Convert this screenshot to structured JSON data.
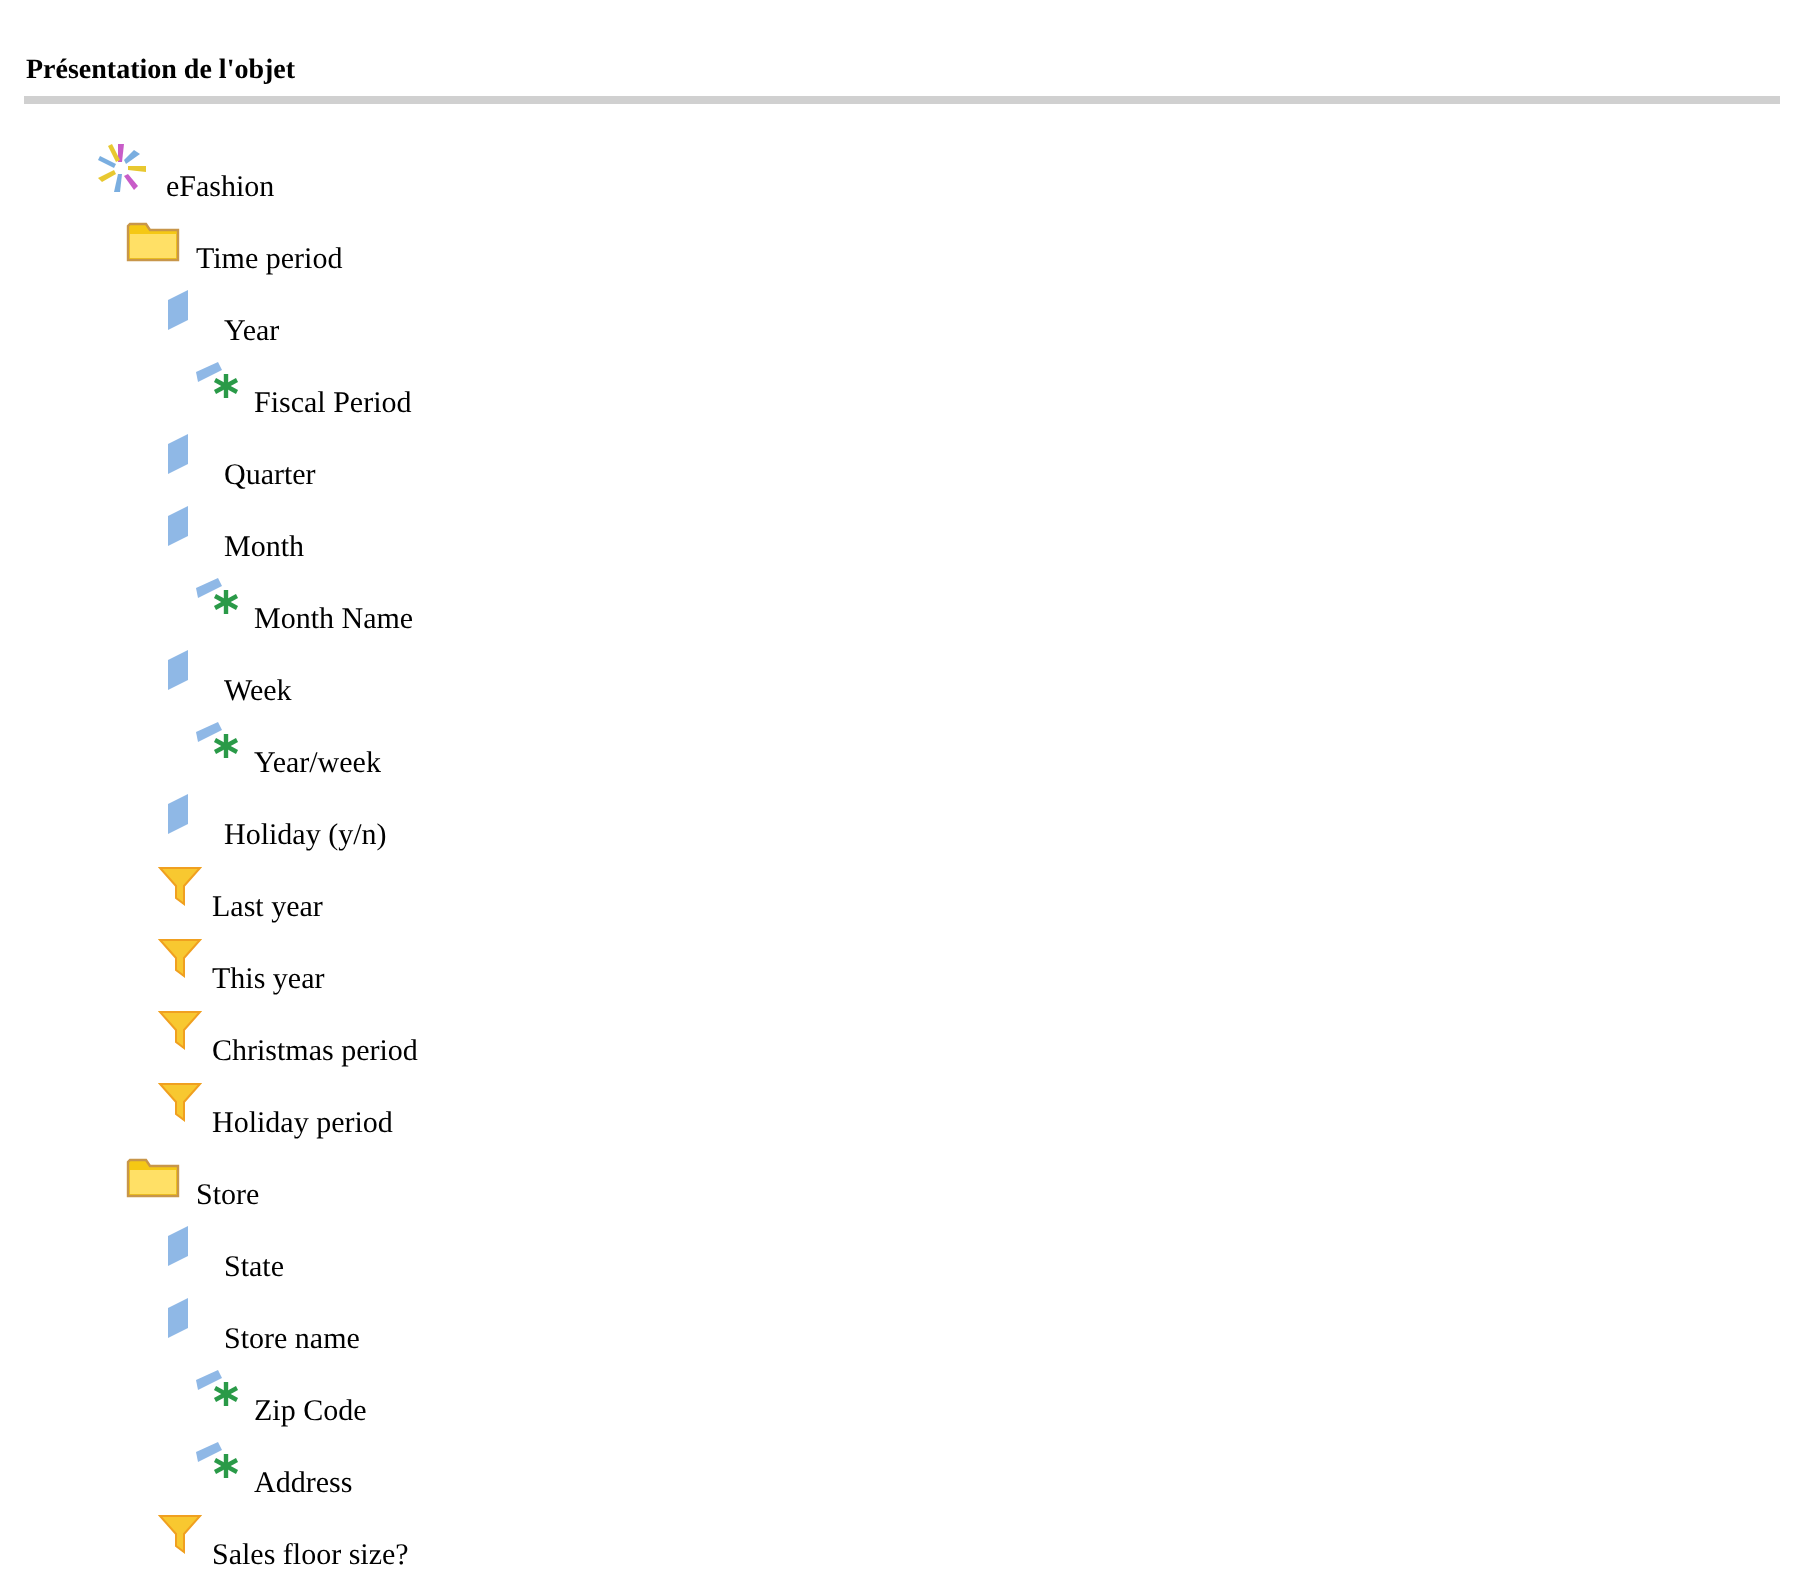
{
  "title": "Présentation de l'objet",
  "tree": [
    {
      "kind": "universe",
      "label": "eFashion",
      "children": [
        {
          "kind": "folder",
          "label": "Time period",
          "children": [
            {
              "kind": "dimension",
              "label": "Year",
              "children": [
                {
                  "kind": "attribute",
                  "label": "Fiscal Period"
                }
              ]
            },
            {
              "kind": "dimension",
              "label": "Quarter"
            },
            {
              "kind": "dimension",
              "label": "Month",
              "children": [
                {
                  "kind": "attribute",
                  "label": "Month Name"
                }
              ]
            },
            {
              "kind": "dimension",
              "label": "Week",
              "children": [
                {
                  "kind": "attribute",
                  "label": "Year/week"
                }
              ]
            },
            {
              "kind": "dimension",
              "label": "Holiday (y/n)"
            },
            {
              "kind": "filter",
              "label": "Last year"
            },
            {
              "kind": "filter",
              "label": "This year"
            },
            {
              "kind": "filter",
              "label": "Christmas period"
            },
            {
              "kind": "filter",
              "label": "Holiday period"
            }
          ]
        },
        {
          "kind": "folder",
          "label": "Store",
          "children": [
            {
              "kind": "dimension",
              "label": "State"
            },
            {
              "kind": "dimension",
              "label": "Store name",
              "children": [
                {
                  "kind": "attribute",
                  "label": "Zip Code"
                },
                {
                  "kind": "attribute",
                  "label": "Address"
                }
              ]
            },
            {
              "kind": "filter",
              "label": "Sales floor size?"
            }
          ]
        }
      ]
    }
  ]
}
